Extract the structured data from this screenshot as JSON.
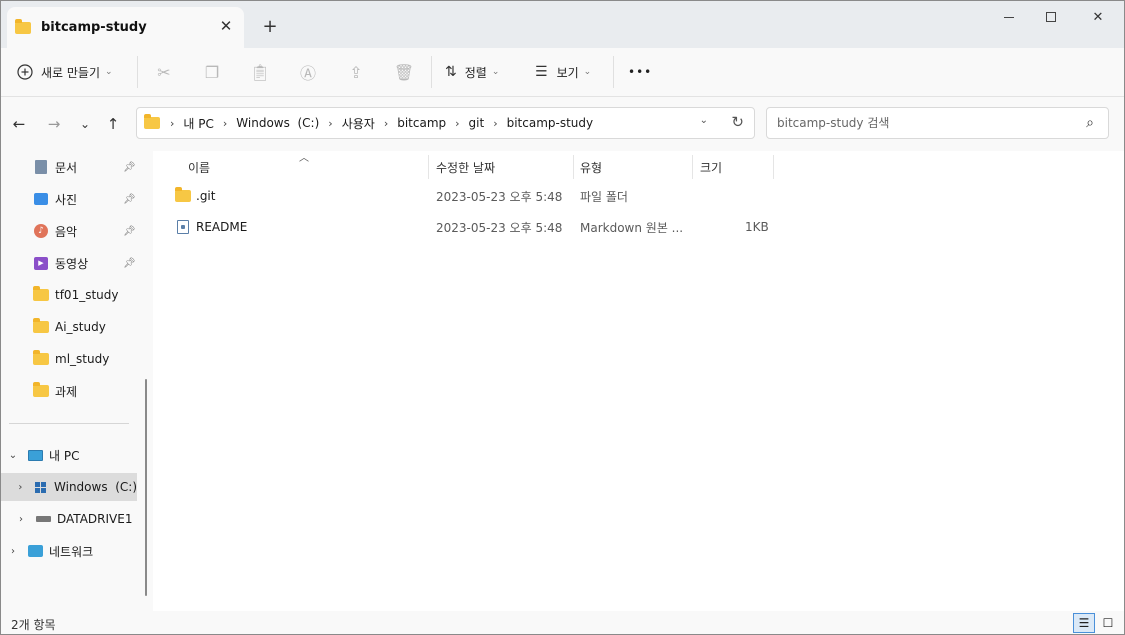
{
  "tab": {
    "title": "bitcamp-study",
    "close": "✕",
    "new": "+"
  },
  "window_controls": {
    "minimize": "",
    "maximize": "",
    "close": "✕"
  },
  "toolbar": {
    "new_label": "새로 만들기",
    "sort_label": "정렬",
    "view_label": "보기",
    "more": "•••"
  },
  "nav": {
    "back": "←",
    "forward": "→",
    "recent": "⌄",
    "up": "↑"
  },
  "address": {
    "crumbs": [
      "내 PC",
      "Windows  (C:)",
      "사용자",
      "bitcamp",
      "git",
      "bitcamp-study"
    ],
    "separator": "›"
  },
  "search": {
    "placeholder": "bitcamp-study 검색"
  },
  "sidebar": {
    "pinned": [
      {
        "label": "문서",
        "icon": "document-icon"
      },
      {
        "label": "사진",
        "icon": "pictures-icon"
      },
      {
        "label": "음악",
        "icon": "music-icon"
      },
      {
        "label": "동영상",
        "icon": "videos-icon"
      }
    ],
    "folders": [
      "tf01_study",
      "Ai_study",
      "ml_study",
      "과제"
    ],
    "this_pc": "내 PC",
    "windows_drive": "Windows  (C:)",
    "data_drive": "DATADRIVE1",
    "network": "네트워크"
  },
  "columns": {
    "name": "이름",
    "modified": "수정한 날짜",
    "type": "유형",
    "size": "크기"
  },
  "files": [
    {
      "name": ".git",
      "modified": "2023-05-23 오후 5:48",
      "type": "파일 폴더",
      "size": ""
    },
    {
      "name": "README",
      "modified": "2023-05-23 오후 5:48",
      "type": "Markdown 원본 ...",
      "size": "1KB"
    }
  ],
  "status": {
    "count": "2개 항목"
  },
  "colors": {
    "folder": "#f7c744",
    "accent": "#4a90d9",
    "selected": "#dcdcdc"
  }
}
